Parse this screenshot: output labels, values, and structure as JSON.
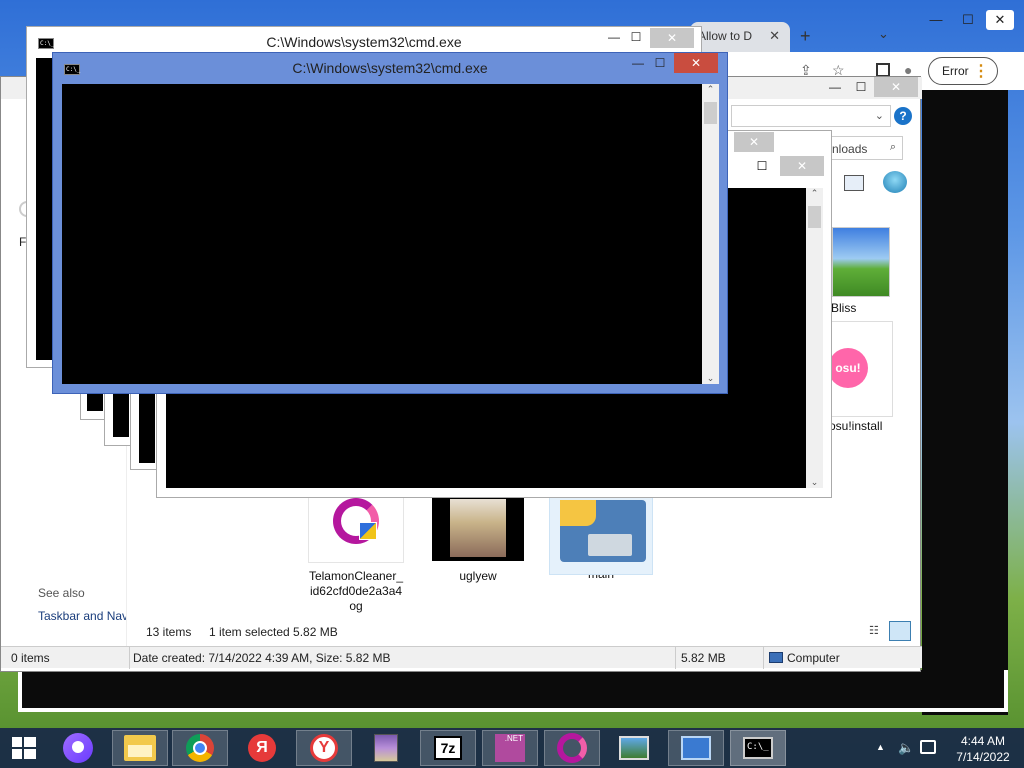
{
  "cmd_front": {
    "title": "C:\\Windows\\system32\\cmd.exe",
    "minimize": "—",
    "maximize": "☐",
    "close": "✕"
  },
  "cmd_back": {
    "title": "C:\\Windows\\system32\\cmd.exe",
    "minimize": "—",
    "maximize": "☐",
    "close": "✕"
  },
  "chrome": {
    "tab_label": "Allow to D",
    "tab_close": "✕",
    "new_tab": "+",
    "tab_list": "⌄",
    "share": "⇪",
    "star": "☆",
    "profile": "●",
    "error_label": "Error",
    "menu": "⋮"
  },
  "explorer": {
    "search_placeholder": "Downloads",
    "help": "?",
    "nav_label": "Fi",
    "see_also": "See also",
    "taskbar_link": "Taskbar and Navigation",
    "files": [
      {
        "name": "Bliss"
      },
      {
        "name": "osu!install",
        "badge": "osu!"
      },
      {
        "name": "TelamonCleaner_id62cfd0de2a3a4og",
        "line1": "TelamonCleaner_",
        "line2": "id62cfd0de2a3a4",
        "line3": "og"
      },
      {
        "name": "uglyew"
      },
      {
        "name": "main"
      }
    ],
    "status_items": "13 items",
    "status_selected": "1 item selected  5.82 MB",
    "statusbar": {
      "items": "0 items",
      "details": "Date created: 7/14/2022 4:39 AM, Size: 5.82 MB",
      "size": "5.82 MB",
      "location": "Computer"
    }
  },
  "taskbar": {
    "apps": [
      "start-button",
      "alice",
      "file-explorer",
      "chrome",
      "yandex-browser",
      "yandex",
      "winrar",
      "7zip",
      "dotnet-installer",
      "opera",
      "photo-viewer",
      "control-panel",
      "cmd"
    ],
    "sevenzip_label": "7z",
    "cmd_label": "C:\\_",
    "net_label": ".NET",
    "ya_label": "Я"
  },
  "tray": {
    "arrow": "▲",
    "time": "4:44 AM",
    "date": "7/14/2022"
  }
}
